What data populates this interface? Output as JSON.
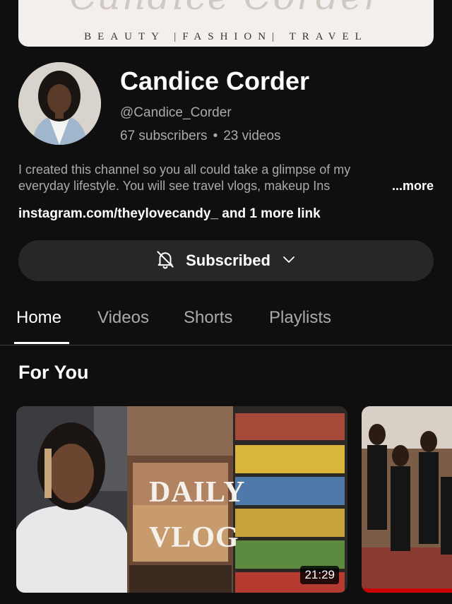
{
  "banner": {
    "script_text": "Candice Corder",
    "tagline": "BEAUTY |FASHION| TRAVEL"
  },
  "channel": {
    "name": "Candice Corder",
    "handle": "@Candice_Corder",
    "subscribers": "67 subscribers",
    "separator": "•",
    "videos": "23 videos",
    "description_line1": "I created this channel so you all could take a glimpse of my",
    "description_line2": "everyday lifestyle. You will see travel vlogs, makeup Ins",
    "more_label": "...more",
    "link_text": "instagram.com/theylovecandy_ and 1 more link"
  },
  "subscribe": {
    "label": "Subscribed",
    "icon": "bell-off-icon"
  },
  "tabs": [
    {
      "label": "Home",
      "active": true
    },
    {
      "label": "Videos",
      "active": false
    },
    {
      "label": "Shorts",
      "active": false
    },
    {
      "label": "Playlists",
      "active": false
    }
  ],
  "section": {
    "title": "For You"
  },
  "videos": [
    {
      "overlay_line1": "DAILY",
      "overlay_line2": "VLOG",
      "duration": "21:29"
    },
    {
      "duration": ""
    }
  ]
}
